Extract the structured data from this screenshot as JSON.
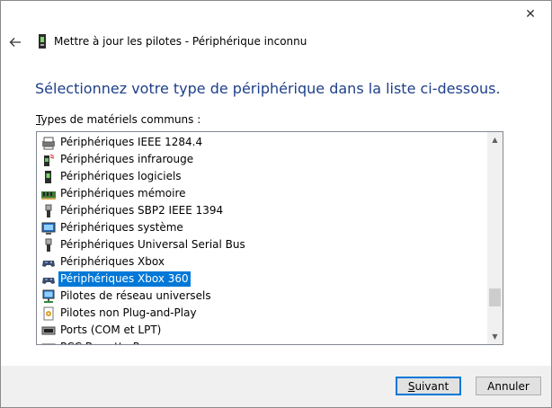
{
  "window": {
    "close_glyph": "✕"
  },
  "header": {
    "back_icon": "back-arrow-icon",
    "title": "Mettre à jour les pilotes - Périphérique inconnu"
  },
  "instruction": "Sélectionnez votre type de périphérique dans la liste ci-dessous.",
  "list": {
    "label": "Types de matériels communs :",
    "selected_index": 7,
    "items": [
      {
        "label": "Périphériques IEEE 1284.4",
        "icon": "printer-port-icon"
      },
      {
        "label": "Périphériques infrarouge",
        "icon": "infrared-icon"
      },
      {
        "label": "Périphériques logiciels",
        "icon": "device-icon"
      },
      {
        "label": "Périphériques mémoire",
        "icon": "memory-icon"
      },
      {
        "label": "Périphériques SBP2 IEEE 1394",
        "icon": "usb-plug-icon"
      },
      {
        "label": "Périphériques système",
        "icon": "system-icon"
      },
      {
        "label": "Périphériques Universal Serial Bus",
        "icon": "usb-plug-icon"
      },
      {
        "label": "Périphériques Xbox",
        "icon": "gamepad-icon"
      },
      {
        "label": "Périphériques Xbox 360",
        "icon": "gamepad-icon"
      },
      {
        "label": "Pilotes de réseau universels",
        "icon": "network-icon"
      },
      {
        "label": "Pilotes non Plug-and-Play",
        "icon": "driver-icon"
      },
      {
        "label": "Ports (COM et LPT)",
        "icon": "port-icon"
      },
      {
        "label": "PCC Barrette P",
        "icon": "port-icon"
      }
    ]
  },
  "buttons": {
    "next": "Suivant",
    "cancel": "Annuler"
  }
}
